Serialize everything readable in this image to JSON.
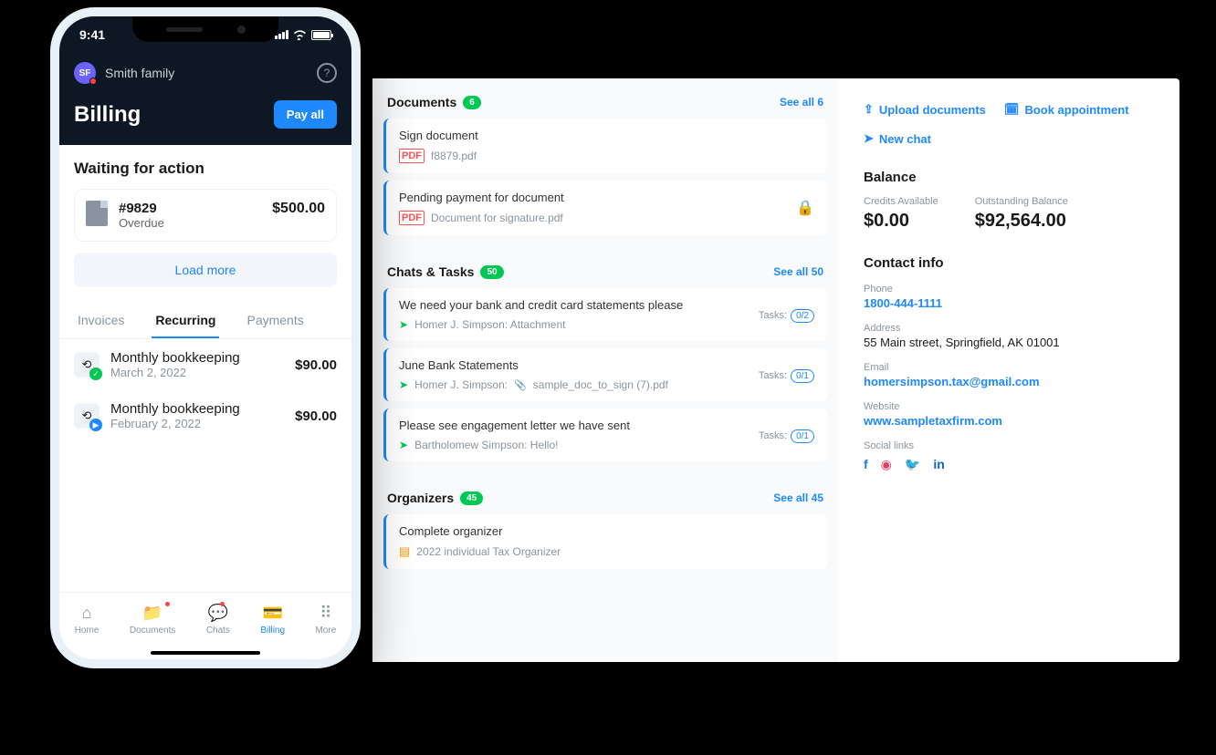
{
  "phone": {
    "time": "9:41",
    "avatar_initials": "SF",
    "user_name": "Smith family",
    "page_title": "Billing",
    "payall_label": "Pay all",
    "waiting_title": "Waiting for action",
    "invoice": {
      "number": "#9829",
      "status": "Overdue",
      "amount": "$500.00"
    },
    "loadmore_label": "Load more",
    "tabs": {
      "invoices": "Invoices",
      "recurring": "Recurring",
      "payments": "Payments"
    },
    "recurring": [
      {
        "title": "Monthly bookkeeping",
        "date": "March 2, 2022",
        "amount": "$90.00"
      },
      {
        "title": "Monthly bookkeeping",
        "date": "February 2, 2022",
        "amount": "$90.00"
      }
    ],
    "tabbar": {
      "home": "Home",
      "documents": "Documents",
      "chats": "Chats",
      "billing": "Billing",
      "more": "More"
    }
  },
  "desktop": {
    "documents": {
      "title": "Documents",
      "count": "6",
      "seeall": "See all 6",
      "items": [
        {
          "title": "Sign document",
          "file": "f8879.pdf"
        },
        {
          "title": "Pending payment for document",
          "file": "Document for signature.pdf"
        }
      ]
    },
    "chats": {
      "title": "Chats & Tasks",
      "count": "50",
      "seeall": "See all 50",
      "tasks_label": "Tasks:",
      "items": [
        {
          "title": "We need your bank and credit card statements please",
          "sub": "Homer J. Simpson: Attachment",
          "tasks": "0/2"
        },
        {
          "title": "June Bank Statements",
          "sub": "Homer J. Simpson:",
          "attach": "sample_doc_to_sign (7).pdf",
          "tasks": "0/1"
        },
        {
          "title": "Please see engagement letter we have sent",
          "sub": "Bartholomew Simpson: Hello!",
          "tasks": "0/1"
        }
      ]
    },
    "organizers": {
      "title": "Organizers",
      "count": "45",
      "seeall": "See all 45",
      "items": [
        {
          "title": "Complete organizer",
          "file": "2022 individual Tax Organizer"
        }
      ]
    },
    "actions": {
      "upload": "Upload documents",
      "book": "Book appointment",
      "newchat": "New chat"
    },
    "balance": {
      "title": "Balance",
      "credits_label": "Credits Available",
      "credits_val": "$0.00",
      "outstanding_label": "Outstanding Balance",
      "outstanding_val": "$92,564.00"
    },
    "contact": {
      "title": "Contact info",
      "phone_label": "Phone",
      "phone": "1800-444-1111",
      "address_label": "Address",
      "address": "55 Main street, Springfield, AK 01001",
      "email_label": "Email",
      "email": "homersimpson.tax@gmail.com",
      "website_label": "Website",
      "website": "www.sampletaxfirm.com",
      "social_label": "Social links"
    }
  }
}
